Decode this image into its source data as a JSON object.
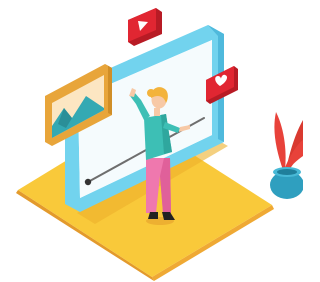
{
  "illustration": {
    "subject": "video-player-with-person",
    "icons": [
      "play-icon",
      "heart-icon",
      "landscape-photo-icon",
      "plant-icon"
    ],
    "palette": {
      "floor": "#F9C93A",
      "floor_edge": "#EFA934",
      "screen_frame": "#72D3EE",
      "screen_frame_side": "#4FB9DC",
      "photo_frame": "#E8A53A",
      "photo_sky": "#FCE6C2",
      "photo_mountain": "#34A9B3",
      "play_badge": "#E12632",
      "heart_badge": "#E12632",
      "shirt": "#3DBFB5",
      "pants": "#EF78AE",
      "hair": "#F3B33C",
      "skin": "#F7C9A6",
      "shoes": "#222222",
      "pot": "#2F9FBF",
      "leaves": "#E8423A"
    }
  }
}
